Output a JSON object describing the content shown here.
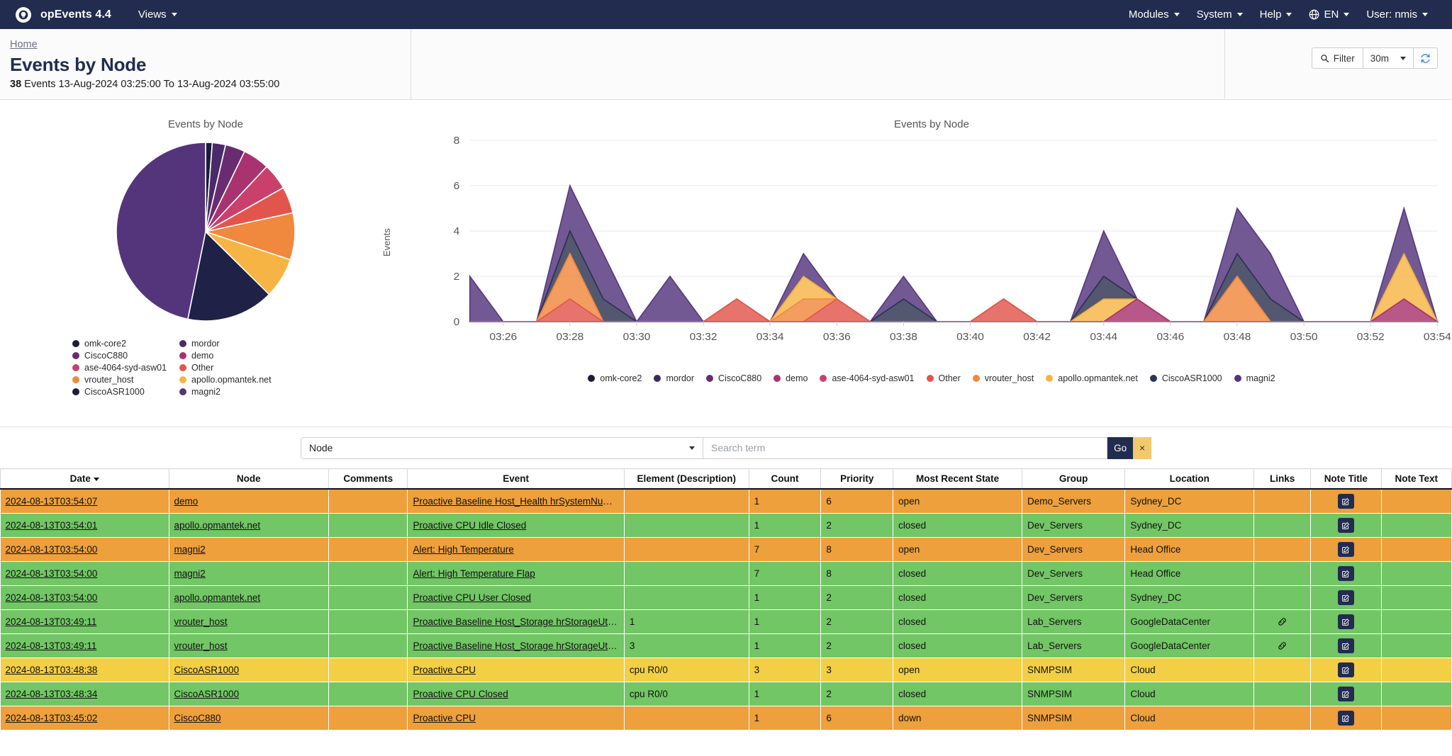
{
  "navbar": {
    "brand": "opEvents 4.4",
    "left_items": [
      {
        "label": "Views",
        "caret": true
      }
    ],
    "right_items": [
      {
        "label": "Modules",
        "caret": true
      },
      {
        "label": "System",
        "caret": true
      },
      {
        "label": "Help",
        "caret": true
      },
      {
        "label": "EN",
        "caret": true,
        "icon": "globe-icon"
      },
      {
        "label": "User: nmis",
        "caret": true
      }
    ]
  },
  "header": {
    "breadcrumb": "Home",
    "title": "Events by Node",
    "count": "38",
    "summary": "Events 13-Aug-2024 03:25:00 To 13-Aug-2024 03:55:00",
    "filter_label": "Filter",
    "range_value": "30m",
    "refresh_icon": "refresh-icon"
  },
  "search": {
    "field_selected": "Node",
    "placeholder": "Search term",
    "go_label": "Go",
    "clear_label": "×"
  },
  "colors": {
    "navy": "#222c4f",
    "open": "#eda03c",
    "closed": "#72c665",
    "warn": "#f2cf44",
    "go_button": "#222c4f",
    "clear_button": "#f2c96b"
  },
  "chart_data": [
    {
      "type": "pie",
      "title": "Events by Node",
      "legend_position": "bottom",
      "categories": [
        "omk-core2",
        "CiscoC880",
        "ase-4064-syd-asw01",
        "vrouter_host",
        "CiscoASR1000",
        "mordor",
        "demo",
        "Other",
        "apollo.opmantek.net",
        "magni2"
      ],
      "colors": [
        "#1b1b3a",
        "#6a2c70",
        "#c9416b",
        "#f0883e",
        "#1b1b3a",
        "#4a2a68",
        "#a8336e",
        "#e2554c",
        "#f6b445",
        "#54357c"
      ],
      "slice_order": [
        "omk-core2",
        "mordor",
        "CiscoC880",
        "demo",
        "ase-4064-syd-asw01",
        "Other",
        "vrouter_host",
        "apollo.opmantek.net",
        "CiscoASR1000",
        "magni2"
      ],
      "slice_colors": [
        "#1b1b3a",
        "#4a2a68",
        "#6a2c70",
        "#a8336e",
        "#c9416b",
        "#e2554c",
        "#f0883e",
        "#f6b445",
        "#1f2147",
        "#54357c"
      ],
      "values": [
        1,
        2,
        3,
        4,
        4,
        4,
        7,
        6,
        13,
        38
      ],
      "percent": [
        1.2,
        2.4,
        3.6,
        4.8,
        4.8,
        4.8,
        8.5,
        7.3,
        15.8,
        46.8
      ]
    },
    {
      "type": "area",
      "stacked": true,
      "title": "Events by Node",
      "xlabel": "",
      "ylabel": "Events",
      "ylim": [
        0,
        8
      ],
      "yticks": [
        0,
        2,
        4,
        6,
        8
      ],
      "grid": true,
      "legend_position": "bottom",
      "x": [
        "03:25",
        "03:26",
        "03:27",
        "03:28",
        "03:29",
        "03:30",
        "03:31",
        "03:32",
        "03:33",
        "03:34",
        "03:35",
        "03:36",
        "03:37",
        "03:38",
        "03:39",
        "03:40",
        "03:41",
        "03:42",
        "03:43",
        "03:44",
        "03:45",
        "03:46",
        "03:47",
        "03:48",
        "03:49",
        "03:50",
        "03:51",
        "03:52",
        "03:53",
        "03:54"
      ],
      "xtick_labels": [
        "03:26",
        "03:28",
        "03:30",
        "03:32",
        "03:34",
        "03:36",
        "03:38",
        "03:40",
        "03:42",
        "03:44",
        "03:46",
        "03:48",
        "03:50",
        "03:52",
        "03:54"
      ],
      "series": [
        {
          "name": "omk-core2",
          "color": "#1b1b3a",
          "values": [
            0,
            0,
            0,
            0,
            0,
            0,
            0,
            0,
            0,
            0,
            0,
            0,
            0,
            0,
            0,
            0,
            0,
            0,
            0,
            0,
            0,
            0,
            0,
            0,
            0,
            0,
            0,
            0,
            0,
            0
          ]
        },
        {
          "name": "mordor",
          "color": "#3c2a5e",
          "values": [
            0,
            0,
            0,
            0,
            0,
            0,
            0,
            0,
            0,
            0,
            0,
            0,
            0,
            0,
            0,
            0,
            0,
            0,
            0,
            0,
            0,
            0,
            0,
            0,
            0,
            0,
            0,
            0,
            0,
            0
          ]
        },
        {
          "name": "CiscoC880",
          "color": "#6a2c70",
          "values": [
            0,
            0,
            0,
            0,
            0,
            0,
            0,
            0,
            0,
            0,
            0,
            0,
            0,
            0,
            0,
            0,
            0,
            0,
            0,
            0,
            0,
            0,
            0,
            0,
            0,
            0,
            0,
            0,
            0,
            0
          ]
        },
        {
          "name": "demo",
          "color": "#a8336e",
          "values": [
            0,
            0,
            0,
            0,
            0,
            0,
            0,
            0,
            0,
            0,
            0,
            0,
            0,
            0,
            0,
            0,
            0,
            0,
            0,
            0,
            1,
            0,
            0,
            0,
            0,
            0,
            0,
            0,
            1,
            0
          ]
        },
        {
          "name": "ase-4064-syd-asw01",
          "color": "#c9416b",
          "values": [
            0,
            0,
            0,
            0,
            0,
            0,
            0,
            0,
            0,
            0,
            0,
            0,
            0,
            0,
            0,
            0,
            0,
            0,
            0,
            0,
            0,
            0,
            0,
            0,
            0,
            0,
            0,
            0,
            0,
            0
          ]
        },
        {
          "name": "Other",
          "color": "#e2554c",
          "values": [
            0,
            0,
            0,
            1,
            0,
            0,
            0,
            0,
            1,
            0,
            0,
            1,
            0,
            0,
            0,
            0,
            1,
            0,
            0,
            0,
            0,
            0,
            0,
            0,
            0,
            0,
            0,
            0,
            0,
            0
          ]
        },
        {
          "name": "vrouter_host",
          "color": "#f0883e",
          "values": [
            0,
            0,
            0,
            2,
            0,
            0,
            0,
            0,
            0,
            0,
            1,
            0,
            0,
            0,
            0,
            0,
            0,
            0,
            0,
            0,
            0,
            0,
            0,
            2,
            0,
            0,
            0,
            0,
            0,
            0
          ]
        },
        {
          "name": "apollo.opmantek.net",
          "color": "#f6b445",
          "values": [
            0,
            0,
            0,
            0,
            0,
            0,
            0,
            0,
            0,
            0,
            1,
            0,
            0,
            0,
            0,
            0,
            0,
            0,
            0,
            1,
            0,
            0,
            0,
            0,
            0,
            0,
            0,
            0,
            2,
            0
          ]
        },
        {
          "name": "CiscoASR1000",
          "color": "#2d3350",
          "values": [
            0,
            0,
            0,
            1,
            1,
            0,
            0,
            0,
            0,
            0,
            0,
            0,
            0,
            1,
            0,
            0,
            0,
            0,
            0,
            1,
            0,
            0,
            0,
            1,
            1,
            0,
            0,
            0,
            0,
            0
          ]
        },
        {
          "name": "magni2",
          "color": "#54357c",
          "values": [
            2,
            0,
            0,
            2,
            2,
            0,
            2,
            0,
            0,
            0,
            1,
            0,
            0,
            1,
            0,
            0,
            0,
            0,
            0,
            2,
            0,
            0,
            0,
            2,
            2,
            0,
            0,
            0,
            2,
            0
          ]
        }
      ],
      "totals": [
        2,
        0,
        0,
        6,
        3,
        0,
        2,
        0,
        1,
        0,
        3,
        1,
        0,
        2,
        0,
        0,
        1,
        0,
        0,
        4,
        1,
        0,
        0,
        5,
        3,
        0,
        0,
        0,
        5,
        0
      ]
    }
  ],
  "table": {
    "columns": [
      {
        "label": "Date",
        "sorted": true
      },
      {
        "label": "Node"
      },
      {
        "label": "Comments"
      },
      {
        "label": "Event"
      },
      {
        "label": "Element (Description)"
      },
      {
        "label": "Count"
      },
      {
        "label": "Priority"
      },
      {
        "label": "Most Recent State"
      },
      {
        "label": "Group"
      },
      {
        "label": "Location"
      },
      {
        "label": "Links"
      },
      {
        "label": "Note Title"
      },
      {
        "label": "Note Text"
      }
    ],
    "rows": [
      {
        "severity": "open",
        "date": "2024-08-13T03:54:07",
        "node": "demo",
        "comments": "",
        "event": "Proactive Baseline Host_Health hrSystemNumUsers",
        "element": "",
        "count": "1",
        "priority": "6",
        "state": "open",
        "group": "Demo_Servers",
        "location": "Sydney_DC",
        "link": false,
        "note_title": "",
        "note_text": ""
      },
      {
        "severity": "closed",
        "date": "2024-08-13T03:54:01",
        "node": "apollo.opmantek.net",
        "comments": "",
        "event": "Proactive CPU Idle Closed",
        "element": "",
        "count": "1",
        "priority": "2",
        "state": "closed",
        "group": "Dev_Servers",
        "location": "Sydney_DC",
        "link": false,
        "note_title": "",
        "note_text": ""
      },
      {
        "severity": "open",
        "date": "2024-08-13T03:54:00",
        "node": "magni2",
        "comments": "",
        "event": "Alert: High Temperature",
        "element": "",
        "count": "7",
        "priority": "8",
        "state": "open",
        "group": "Dev_Servers",
        "location": "Head Office",
        "link": false,
        "note_title": "",
        "note_text": ""
      },
      {
        "severity": "closed",
        "date": "2024-08-13T03:54:00",
        "node": "magni2",
        "comments": "",
        "event": "Alert: High Temperature Flap",
        "element": "",
        "count": "7",
        "priority": "8",
        "state": "closed",
        "group": "Dev_Servers",
        "location": "Head Office",
        "link": false,
        "note_title": "",
        "note_text": ""
      },
      {
        "severity": "closed",
        "date": "2024-08-13T03:54:00",
        "node": "apollo.opmantek.net",
        "comments": "",
        "event": "Proactive CPU User Closed",
        "element": "",
        "count": "1",
        "priority": "2",
        "state": "closed",
        "group": "Dev_Servers",
        "location": "Sydney_DC",
        "link": false,
        "note_title": "",
        "note_text": ""
      },
      {
        "severity": "closed",
        "date": "2024-08-13T03:49:11",
        "node": "vrouter_host",
        "comments": "",
        "event": "Proactive Baseline Host_Storage hrStorageUtil Closed",
        "element": "1",
        "count": "1",
        "priority": "2",
        "state": "closed",
        "group": "Lab_Servers",
        "location": "GoogleDataCenter",
        "link": true,
        "note_title": "",
        "note_text": ""
      },
      {
        "severity": "closed",
        "date": "2024-08-13T03:49:11",
        "node": "vrouter_host",
        "comments": "",
        "event": "Proactive Baseline Host_Storage hrStorageUtil Closed",
        "element": "3",
        "count": "1",
        "priority": "2",
        "state": "closed",
        "group": "Lab_Servers",
        "location": "GoogleDataCenter",
        "link": true,
        "note_title": "",
        "note_text": ""
      },
      {
        "severity": "warn",
        "date": "2024-08-13T03:48:38",
        "node": "CiscoASR1000",
        "comments": "",
        "event": "Proactive CPU",
        "element": "cpu R0/0",
        "count": "3",
        "priority": "3",
        "state": "open",
        "group": "SNMPSIM",
        "location": "Cloud",
        "link": false,
        "note_title": "",
        "note_text": ""
      },
      {
        "severity": "closed",
        "date": "2024-08-13T03:48:34",
        "node": "CiscoASR1000",
        "comments": "",
        "event": "Proactive CPU Closed",
        "element": "cpu R0/0",
        "count": "1",
        "priority": "2",
        "state": "closed",
        "group": "SNMPSIM",
        "location": "Cloud",
        "link": false,
        "note_title": "",
        "note_text": ""
      },
      {
        "severity": "open",
        "date": "2024-08-13T03:45:02",
        "node": "CiscoC880",
        "comments": "",
        "event": "Proactive CPU",
        "element": "",
        "count": "1",
        "priority": "6",
        "state": "down",
        "group": "SNMPSIM",
        "location": "Cloud",
        "link": false,
        "note_title": "",
        "note_text": ""
      }
    ]
  }
}
